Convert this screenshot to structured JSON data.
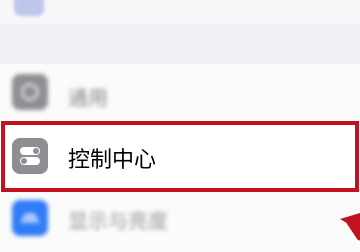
{
  "settings": {
    "items": [
      {
        "label": "通用",
        "icon": "gear-icon"
      },
      {
        "label": "控制中心",
        "icon": "control-center-icon"
      },
      {
        "label": "显示与亮度",
        "icon": "display-brightness-icon"
      }
    ]
  },
  "annotation": {
    "highlight_color": "#c1121f",
    "arrow_color": "#c1121f"
  }
}
